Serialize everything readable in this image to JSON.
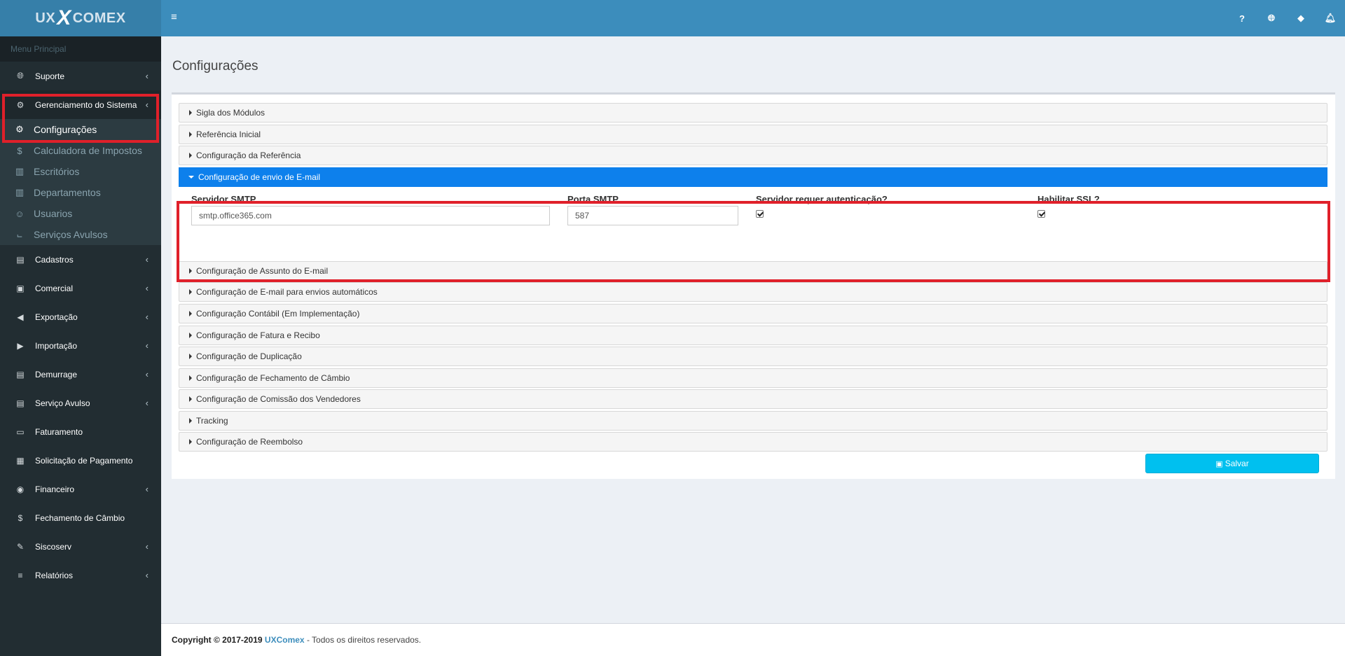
{
  "logo": {
    "ux": "UX",
    "x": "X",
    "comex": "COMEX"
  },
  "sidebar": {
    "header": "Menu Principal",
    "top_items": [
      {
        "label": "Suporte",
        "icon": "globe-icon"
      },
      {
        "label": "Gerenciamento do Sistema",
        "icon": "cogs-icon"
      }
    ],
    "sub_items": [
      {
        "label": "Configurações",
        "icon": "gear-icon"
      },
      {
        "label": "Calculadora de Impostos",
        "icon": "dollar-icon"
      },
      {
        "label": "Escritórios",
        "icon": "building-icon"
      },
      {
        "label": "Departamentos",
        "icon": "building-icon"
      },
      {
        "label": "Usuarios",
        "icon": "user-plus-icon"
      },
      {
        "label": "Serviços Avulsos",
        "icon": "cart-icon"
      }
    ],
    "items": [
      {
        "label": "Cadastros",
        "icon": "book-icon"
      },
      {
        "label": "Comercial",
        "icon": "briefcase-icon"
      },
      {
        "label": "Exportação",
        "icon": "arrow-circle-left-icon"
      },
      {
        "label": "Importação",
        "icon": "arrow-circle-right-icon"
      },
      {
        "label": "Demurrage",
        "icon": "file-icon"
      },
      {
        "label": "Serviço Avulso",
        "icon": "file-icon"
      },
      {
        "label": "Faturamento",
        "icon": "credit-card-icon"
      },
      {
        "label": "Solicitação de Pagamento",
        "icon": "calculator-icon"
      },
      {
        "label": "Financeiro",
        "icon": "money-icon"
      },
      {
        "label": "Fechamento de Câmbio",
        "icon": "dollar-icon"
      },
      {
        "label": "Siscoserv",
        "icon": "edit-icon"
      },
      {
        "label": "Relatórios",
        "icon": "database-icon"
      }
    ]
  },
  "topbar": {
    "icons": [
      "question-icon",
      "globe-icon",
      "ticket-icon",
      "bell-icon"
    ],
    "help_glyph": "?"
  },
  "page": {
    "title": "Configurações",
    "panels_before": [
      "Sigla dos Módulos",
      "Referência Inicial",
      "Configuração da Referência"
    ],
    "open_panel": {
      "title": "Configuração de envio de E-mail",
      "smtp_server_label": "Servidor SMTP",
      "smtp_server_value": "smtp.office365.com",
      "smtp_port_label": "Porta SMTP",
      "smtp_port_value": "587",
      "auth_label": "Servidor requer autenticação?",
      "auth_checked": true,
      "ssl_label": "Habilitar SSL?",
      "ssl_checked": true
    },
    "panels_after": [
      "Configuração de Assunto do E-mail",
      "Configuração de E-mail para envios automáticos",
      "Configuração Contábil (Em Implementação)",
      "Configuração de Fatura e Recibo",
      "Configuração de Duplicação",
      "Configuração de Fechamento de Câmbio",
      "Configuração de Comissão dos Vendedores",
      "Tracking",
      "Configuração de Reembolso"
    ],
    "save_label": "Salvar"
  },
  "footer": {
    "copyright": "Copyright © 2017-2019",
    "brand": "UXComex",
    "rest": "- Todos os direitos reservados."
  },
  "colors": {
    "sidebar_bg": "#222d32",
    "header_bg": "#3c8dbc",
    "logo_bg": "#367fa9",
    "open_panel_bg": "#0d80ec",
    "save_button": "#00c0ef",
    "highlight_red": "#e0202a"
  }
}
